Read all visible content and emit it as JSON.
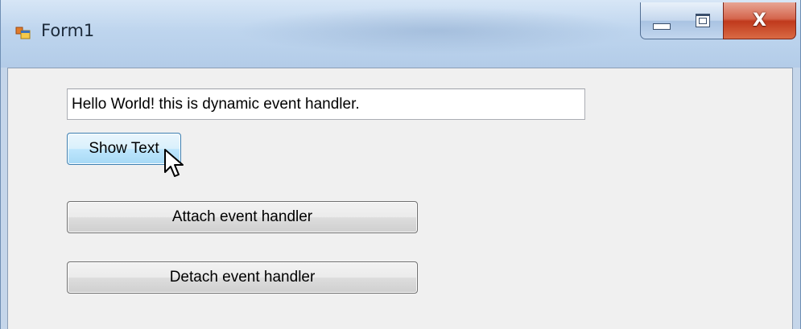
{
  "window": {
    "title": "Form1",
    "icons": {
      "app": "form-app-icon",
      "minimize": "minimize-icon",
      "maximize": "maximize-icon",
      "close": "close-icon"
    },
    "close_glyph": "X"
  },
  "form": {
    "textbox_value": "Hello World! this is dynamic event handler.",
    "show_text_label": "Show Text",
    "attach_label": "Attach event handler",
    "detach_label": "Detach event handler"
  },
  "colors": {
    "client_background": "#f0f0f0",
    "titlebar": "#bed5ee",
    "close_button": "#c0391c",
    "focused_button": "#bee6fd"
  }
}
